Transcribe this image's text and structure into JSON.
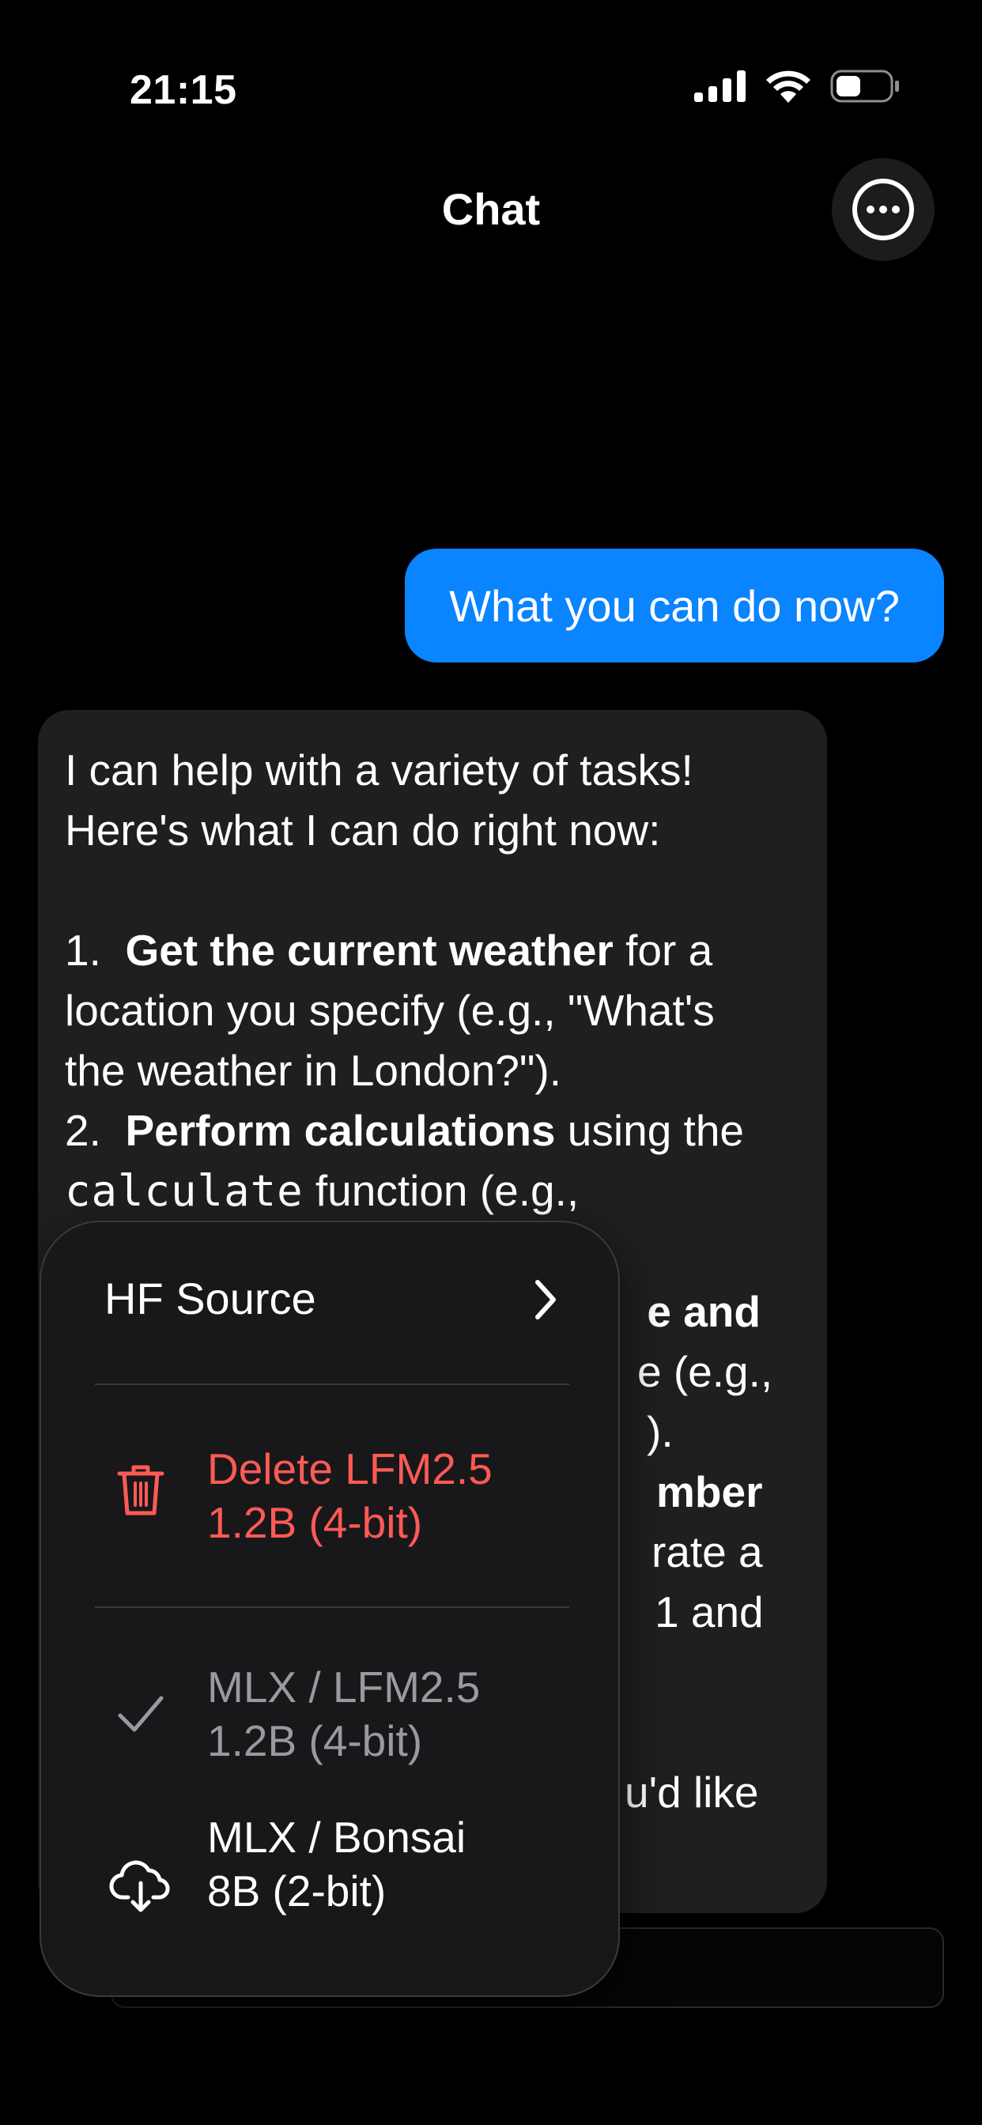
{
  "status_bar": {
    "time": "21:15"
  },
  "nav": {
    "title": "Chat",
    "more_icon": "ellipsis-circle-icon"
  },
  "messages": {
    "user": "What you can do now?",
    "assistant": {
      "intro_line1": "I can help with a variety of tasks!",
      "intro_line2": "Here's what I can do right now:",
      "item1_num": "1.",
      "item1_bold": "Get the current weather",
      "item1_rest_a": " for a",
      "item1_line2": "location you specify (e.g., \"What's",
      "item1_line3": "the weather in London?\").",
      "item2_num": "2.",
      "item2_bold": "Perform calculations",
      "item2_rest_a": " using the",
      "item2_code": "calculate",
      "item2_rest_b": " function (e.g.,",
      "frag_and": "e and",
      "frag_eg": "e (e.g.,",
      "frag_paren": ").",
      "frag_mber": "mber",
      "frag_rate": "rate a",
      "frag_1and": "1 and",
      "frag_like": "u'd like"
    }
  },
  "menu": {
    "hf_source": "HF Source",
    "delete_line1": "Delete LFM2.5",
    "delete_line2": "1.2B (4-bit)",
    "model1_line1": "MLX / LFM2.5",
    "model1_line2": "1.2B (4-bit)",
    "model2_line1": "MLX / Bonsai",
    "model2_line2": "8B (2-bit)",
    "icons": {
      "chevron": "chevron-right-icon",
      "delete": "trash-icon",
      "selected": "checkmark-icon",
      "download": "cloud-download-icon"
    },
    "colors": {
      "delete": "#ff5a55",
      "user_bubble": "#0a84ff"
    }
  }
}
